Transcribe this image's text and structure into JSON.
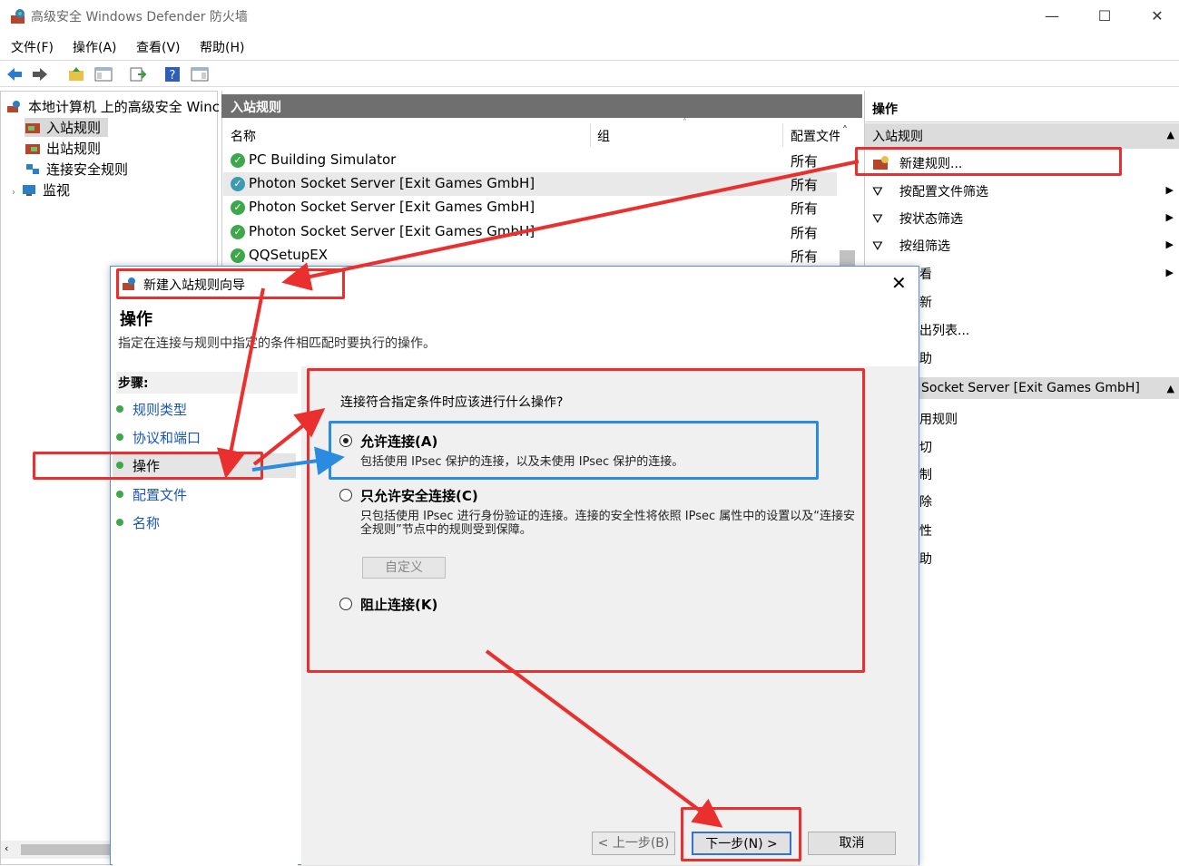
{
  "app": {
    "title": "高级安全 Windows Defender 防火墙"
  },
  "window_controls": {
    "minimize": "—",
    "maximize": "☐",
    "close": "✕"
  },
  "menu": [
    "文件(F)",
    "操作(A)",
    "查看(V)",
    "帮助(H)"
  ],
  "tree": {
    "root": "本地计算机 上的高级安全 Winc",
    "items": [
      "入站规则",
      "出站规则",
      "连接安全规则",
      "监视"
    ]
  },
  "center": {
    "header": "入站规则",
    "columns": {
      "name": "名称",
      "group": "组",
      "profile": "配置文件"
    },
    "rows": [
      {
        "name": "PC Building Simulator",
        "profile": "所有"
      },
      {
        "name": "Photon Socket Server [Exit Games GmbH]",
        "profile": "所有"
      },
      {
        "name": "Photon Socket Server [Exit Games GmbH]",
        "profile": "所有"
      },
      {
        "name": "Photon Socket Server [Exit Games GmbH]",
        "profile": "所有"
      },
      {
        "name": "QQSetupEX",
        "profile": "所有"
      }
    ]
  },
  "actions": {
    "header": "操作",
    "section1": "入站规则",
    "items": [
      "新建规则...",
      "按配置文件筛选",
      "按状态筛选",
      "按组筛选",
      "看",
      "新",
      "出列表...",
      "助"
    ],
    "section2": "Socket Server [Exit Games GmbH]",
    "items2": [
      "用规则",
      "切",
      "制",
      "除",
      "性",
      "助"
    ]
  },
  "dialog": {
    "title": "新建入站规则向导",
    "close": "✕",
    "heading": "操作",
    "description": "指定在连接与规则中指定的条件相匹配时要执行的操作。",
    "steps_header": "步骤:",
    "steps": [
      "规则类型",
      "协议和端口",
      "操作",
      "配置文件",
      "名称"
    ],
    "question": "连接符合指定条件时应该进行什么操作?",
    "options": [
      {
        "label": "允许连接(A)",
        "desc": "包括使用 IPsec 保护的连接，以及未使用 IPsec 保护的连接。",
        "selected": true
      },
      {
        "label": "只允许安全连接(C)",
        "desc": "只包括使用 IPsec 进行身份验证的连接。连接的安全性将依照 IPsec 属性中的设置以及“连接安全规则”节点中的规则受到保障。",
        "selected": false
      },
      {
        "label": "阻止连接(K)",
        "desc": "",
        "selected": false
      }
    ],
    "customize": "自定义",
    "buttons": {
      "back": "< 上一步(B)",
      "next": "下一步(N) >",
      "cancel": "取消"
    }
  },
  "colors": {
    "annotation_red": "#ea2f2f",
    "annotation_blue": "#2b8be0",
    "header_gray": "#6f6f6f"
  }
}
